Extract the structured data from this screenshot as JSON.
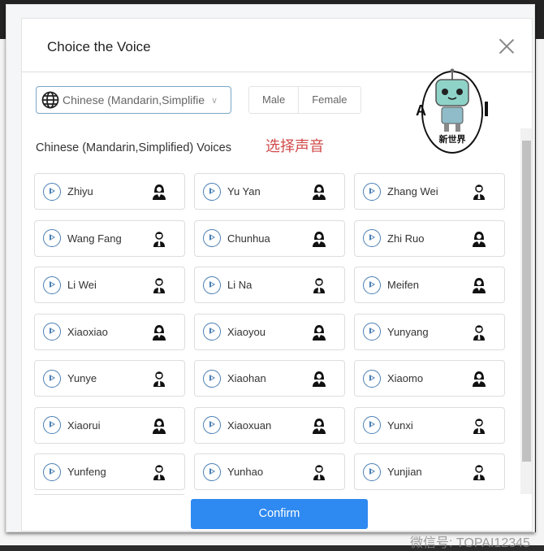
{
  "dialog": {
    "title": "Choice the Voice",
    "close_icon": "close-icon"
  },
  "language_select": {
    "value": "Chinese (Mandarin,Simplified)",
    "icon": "globe-icon"
  },
  "gender_filter": {
    "male": "Male",
    "female": "Female"
  },
  "logo": {
    "text_left": "A",
    "text_right": "I",
    "caption": "新世界"
  },
  "section_title": "Chinese (Mandarin,Simplified) Voices",
  "annotation": "选择声音",
  "voices": [
    {
      "name": "Zhiyu",
      "gender": "female"
    },
    {
      "name": "Yu Yan",
      "gender": "female"
    },
    {
      "name": "Zhang Wei",
      "gender": "male"
    },
    {
      "name": "Wang Fang",
      "gender": "male"
    },
    {
      "name": "Chunhua",
      "gender": "female"
    },
    {
      "name": "Zhi Ruo",
      "gender": "female"
    },
    {
      "name": "Li Wei",
      "gender": "male"
    },
    {
      "name": "Li Na",
      "gender": "male"
    },
    {
      "name": "Meifen",
      "gender": "female"
    },
    {
      "name": "Xiaoxiao",
      "gender": "female"
    },
    {
      "name": "Xiaoyou",
      "gender": "female"
    },
    {
      "name": "Yunyang",
      "gender": "male"
    },
    {
      "name": "Yunye",
      "gender": "male"
    },
    {
      "name": "Xiaohan",
      "gender": "female"
    },
    {
      "name": "Xiaomo",
      "gender": "female"
    },
    {
      "name": "Xiaorui",
      "gender": "female"
    },
    {
      "name": "Xiaoxuan",
      "gender": "female"
    },
    {
      "name": "Yunxi",
      "gender": "male"
    },
    {
      "name": "Yunfeng",
      "gender": "male"
    },
    {
      "name": "Yunhao",
      "gender": "male"
    },
    {
      "name": "Yunjian",
      "gender": "male"
    }
  ],
  "confirm_label": "Confirm",
  "watermark": "微信号: TOPAI12345",
  "colors": {
    "accent": "#2e89f0",
    "annotation": "#d24b4b",
    "play": "#4a7fb5"
  }
}
